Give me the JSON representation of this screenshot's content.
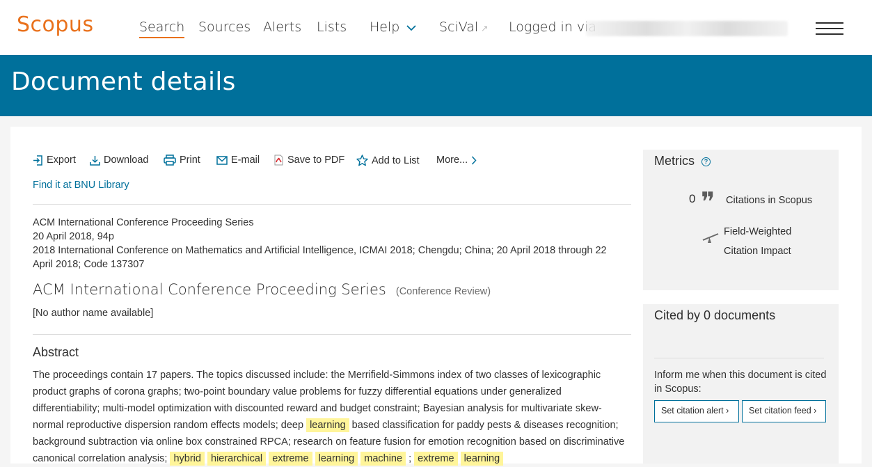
{
  "header": {
    "logo": "Scopus",
    "nav": {
      "search": "Search",
      "sources": "Sources",
      "alerts": "Alerts",
      "lists": "Lists",
      "help": "Help",
      "scival": "SciVal",
      "login": "Logged in via"
    }
  },
  "banner": {
    "title": "Document details"
  },
  "toolbar": {
    "export": "Export",
    "download": "Download",
    "print": "Print",
    "email": "E-mail",
    "save_pdf": "Save to PDF",
    "add_list": "Add to List",
    "more": "More..."
  },
  "find_link": "Find it at BNU Library",
  "meta": {
    "source": "ACM International Conference Proceeding Series",
    "date_pages": "20 April 2018, 94p",
    "conference_line1": "2018 International Conference on Mathematics and Artificial Intelligence, ICMAI 2018; Chengdu; China; 20 April 2018 through 22",
    "conference_line2": "April 2018; Code 137307"
  },
  "document": {
    "title": "ACM International Conference Proceeding Series",
    "type": "(Conference Review)",
    "authors": "[No author name available]"
  },
  "abstract": {
    "heading": "Abstract",
    "p1": "The proceedings contain 17 papers. The topics discussed include: the Merrifield-Simmons index of two classes of lexicographic product graphs of corona graphs; two-point boundary value problems for fuzzy differential equations under generalized differentiability; multi-model optimization with discounted reward and budget constraint; Bayesian analysis for multivariate skew-normal reproductive dispersion random effects models; deep ",
    "hl1": "learning",
    "p2": " based classification for paddy pests & diseases recognition; background subtraction via online box constrained RPCA; research on feature fusion for emotion recognition based on discriminative canonical correlation analysis; ",
    "hl2": "hybrid",
    "hl3": "hierarchical",
    "hl4": "extreme",
    "hl5": "learning",
    "hl6": "machine",
    "sep": " ; ",
    "hl7": "extreme",
    "hl8": "learning"
  },
  "metrics": {
    "title": "Metrics",
    "citations": "0",
    "citations_label": "Citations in Scopus",
    "fwci_line1": "Field-Weighted",
    "fwci_line2": "Citation Impact"
  },
  "cited_by": {
    "title": "Cited by 0 documents",
    "inform": "Inform me when this document is cited in Scopus:",
    "alert_btn": "Set citation alert",
    "feed_btn": "Set citation feed"
  }
}
